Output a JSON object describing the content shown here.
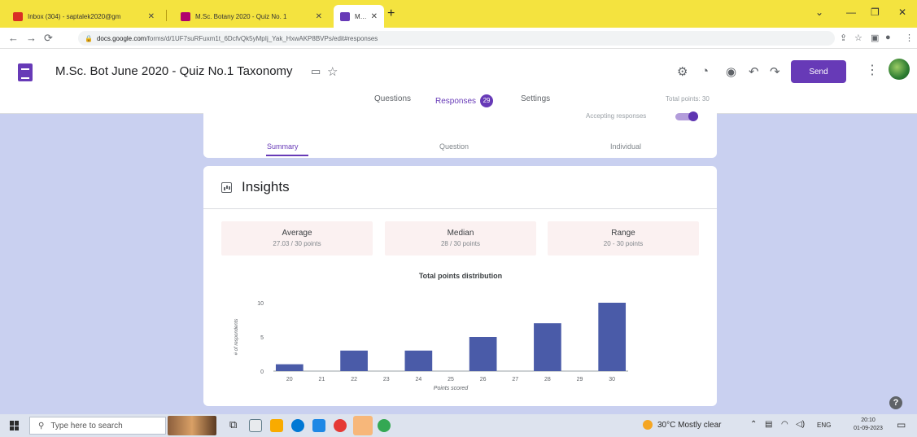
{
  "browser": {
    "tabs": [
      {
        "title": "Inbox (304) - saptalek2020@gm",
        "favicon_color": "#d93025",
        "active": false
      },
      {
        "title": "M.Sc. Botany 2020 - Quiz No. 1",
        "favicon_color": "#b0006d",
        "active": false
      },
      {
        "title": "M.Sc. Bot June 2020 - Quiz No. 1",
        "favicon_color": "#673ab7",
        "active": true
      }
    ],
    "url_host": "docs.google.com",
    "url_path": "/forms/d/1UF7suRFuxm1t_6DcfvQk5yMpIj_Yak_HxwAKP8BVPs/edit#responses"
  },
  "form": {
    "title": "M.Sc. Bot June 2020 - Quiz No.1 Taxonomy",
    "send_label": "Send",
    "nav": {
      "questions": "Questions",
      "responses": "Responses",
      "responses_count": "29",
      "settings": "Settings"
    },
    "total_points": "Total points: 30",
    "accepting_label": "Accepting responses",
    "accepting_on": true,
    "subtabs": {
      "summary": "Summary",
      "question": "Question",
      "individual": "Individual"
    }
  },
  "insights": {
    "title": "Insights",
    "stats": [
      {
        "label": "Average",
        "value": "27.03 / 30 points"
      },
      {
        "label": "Median",
        "value": "28 / 30 points"
      },
      {
        "label": "Range",
        "value": "20 - 30 points"
      }
    ]
  },
  "chart_data": {
    "type": "bar",
    "title": "Total points distribution",
    "xlabel": "Points scored",
    "ylabel": "# of respondents",
    "categories": [
      "20",
      "21",
      "22",
      "23",
      "24",
      "25",
      "26",
      "27",
      "28",
      "29",
      "30"
    ],
    "values": [
      1,
      0,
      3,
      0,
      3,
      0,
      5,
      0,
      7,
      0,
      10
    ],
    "ylim": [
      0,
      10
    ],
    "yticks": [
      0,
      5,
      10
    ],
    "color": "#4a5ba8",
    "grid": false
  },
  "taskbar": {
    "search_placeholder": "Type here to search",
    "weather": "30°C  Mostly clear",
    "language": "ENG",
    "time": "20:10",
    "date": "01-09-2023"
  },
  "colors": {
    "accent": "#673ab7",
    "page_background": "#c9d0f0",
    "tab_strip": "#f4e33f"
  }
}
